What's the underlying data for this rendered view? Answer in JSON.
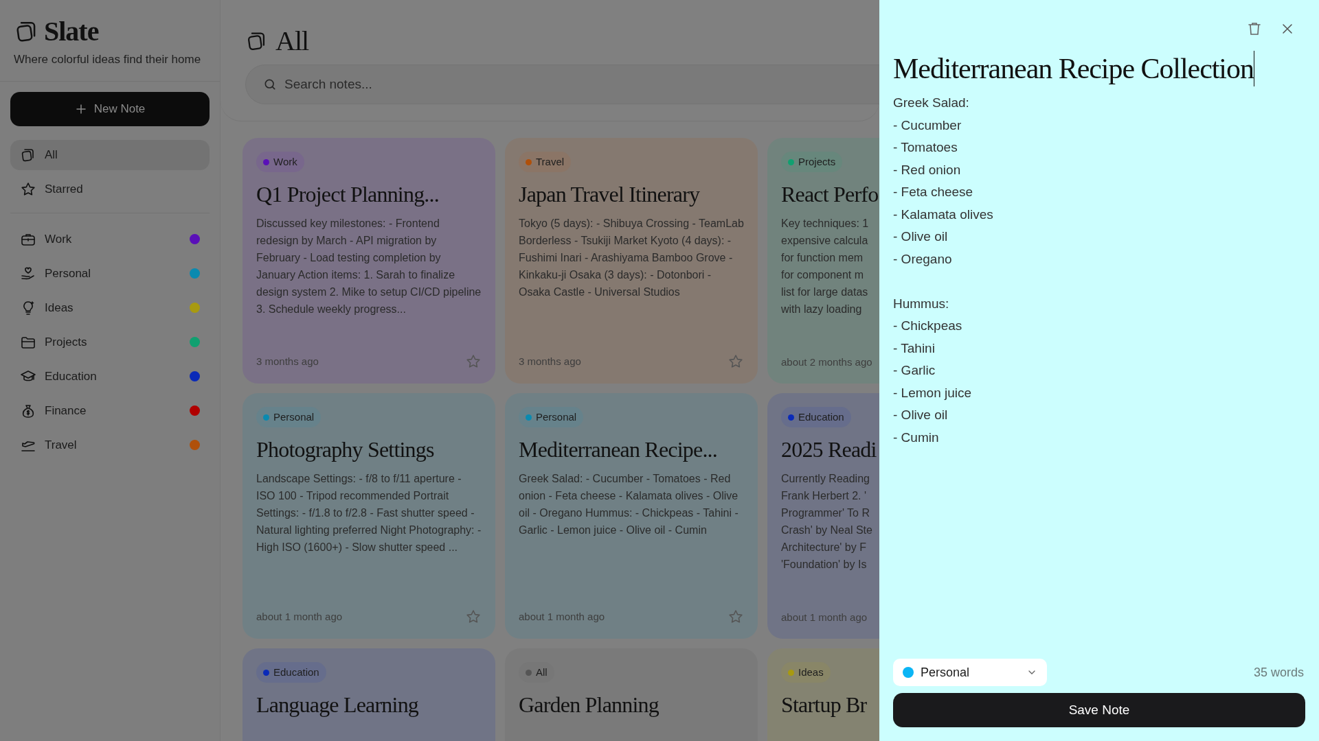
{
  "app": {
    "name": "Slate",
    "tagline": "Where colorful ideas find their home"
  },
  "new_note_button": "New Note",
  "nav": [
    {
      "label": "All",
      "selected": true
    },
    {
      "label": "Starred",
      "selected": false
    }
  ],
  "categories": [
    {
      "label": "Work",
      "color": "#5a10b8",
      "selected": false
    },
    {
      "label": "Personal",
      "color": "#0a8ab0",
      "selected": false
    },
    {
      "label": "Ideas",
      "color": "#a89a10",
      "selected": false
    },
    {
      "label": "Projects",
      "color": "#10a070",
      "selected": false
    },
    {
      "label": "Education",
      "color": "#0a2ab8",
      "selected": false
    },
    {
      "label": "Finance",
      "color": "#b00000",
      "selected": false
    },
    {
      "label": "Travel",
      "color": "#b0500a",
      "selected": false
    }
  ],
  "header": {
    "title": "All"
  },
  "search": {
    "placeholder": "Search notes..."
  },
  "notes": [
    {
      "tag": "Work",
      "color": "#5a10b8",
      "title": "Q1 Project Planning...",
      "body": "Discussed key milestones: - Frontend redesign by March - API migration by February - Load testing completion by January Action items: 1. Sarah to finalize design system 2. Mike to setup CI/CD pipeline 3. Schedule weekly progress...",
      "time": "3 months ago",
      "starred": false
    },
    {
      "tag": "Travel",
      "color": "#b0500a",
      "title": "Japan Travel Itinerary",
      "body": "Tokyo (5 days): - Shibuya Crossing - TeamLab Borderless - Tsukiji Market Kyoto (4 days): - Fushimi Inari - Arashiyama Bamboo Grove - Kinkaku-ji Osaka (3 days): - Dotonbori - Osaka Castle - Universal Studios",
      "time": "3 months ago",
      "starred": false
    },
    {
      "tag": "Projects",
      "color": "#10a070",
      "title": "React Perfo",
      "body": "Key techniques: 1\nexpensive calcula\nfor function mem\nfor component m\nlist for large datas\nwith lazy loading",
      "time": "about 2 months ago"
    },
    {
      "tag": "Personal",
      "color": "#0a8ab0",
      "title": "Photography Settings",
      "body": "Landscape Settings: - f/8 to f/11 aperture - ISO 100 - Tripod recommended Portrait Settings: - f/1.8 to f/2.8 - Fast shutter speed - Natural lighting preferred Night Photography: - High ISO (1600+) - Slow shutter speed ...",
      "time": "about 1 month ago",
      "starred": false
    },
    {
      "tag": "Personal",
      "color": "#0a8ab0",
      "title": "Mediterranean Recipe...",
      "body": "Greek Salad: - Cucumber - Tomatoes - Red onion - Feta cheese - Kalamata olives - Olive oil - Oregano Hummus: - Chickpeas - Tahini - Garlic - Lemon juice - Olive oil - Cumin",
      "time": "about 1 month ago",
      "starred": false
    },
    {
      "tag": "Education",
      "color": "#0a2ab8",
      "title": "2025 Readi",
      "body": "Currently Reading\nFrank Herbert 2. '\nProgrammer' To R\nCrash' by Neal Ste\nArchitecture' by F\n'Foundation' by Is",
      "time": "about 1 month ago"
    },
    {
      "tag": "Education",
      "color": "#0a2ab8",
      "title": "Language Learning"
    },
    {
      "tag": "All",
      "color": "#555555",
      "title": "Garden Planning"
    },
    {
      "tag": "Ideas",
      "color": "#a89a10",
      "title": "Startup Br"
    }
  ],
  "editor": {
    "title": "Mediterranean Recipe Collection",
    "content": "Greek Salad:\n- Cucumber\n- Tomatoes\n- Red onion\n- Feta cheese\n- Kalamata olives\n- Olive oil\n- Oregano\n\nHummus:\n- Chickpeas\n- Tahini\n- Garlic\n- Lemon juice\n- Olive oil\n- Cumin",
    "category": {
      "label": "Personal",
      "color": "#0bb5f5"
    },
    "word_count": "35 words",
    "save_button": "Save Note"
  }
}
